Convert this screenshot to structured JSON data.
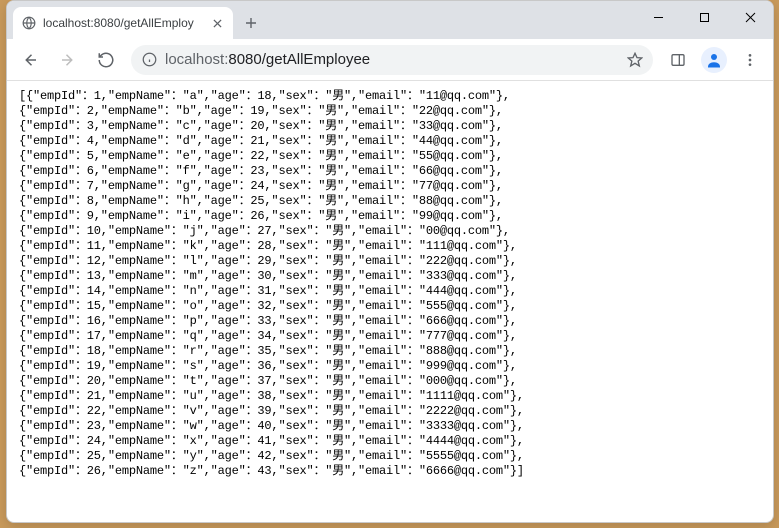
{
  "tab": {
    "title": "localhost:8080/getAllEmploy"
  },
  "url": {
    "host": "localhost:",
    "port_path": "8080/getAllEmployee"
  },
  "employees": [
    {
      "empId": 1,
      "empName": "a",
      "age": 18,
      "sex": "男",
      "email": "11@qq.com"
    },
    {
      "empId": 2,
      "empName": "b",
      "age": 19,
      "sex": "男",
      "email": "22@qq.com"
    },
    {
      "empId": 3,
      "empName": "c",
      "age": 20,
      "sex": "男",
      "email": "33@qq.com"
    },
    {
      "empId": 4,
      "empName": "d",
      "age": 21,
      "sex": "男",
      "email": "44@qq.com"
    },
    {
      "empId": 5,
      "empName": "e",
      "age": 22,
      "sex": "男",
      "email": "55@qq.com"
    },
    {
      "empId": 6,
      "empName": "f",
      "age": 23,
      "sex": "男",
      "email": "66@qq.com"
    },
    {
      "empId": 7,
      "empName": "g",
      "age": 24,
      "sex": "男",
      "email": "77@qq.com"
    },
    {
      "empId": 8,
      "empName": "h",
      "age": 25,
      "sex": "男",
      "email": "88@qq.com"
    },
    {
      "empId": 9,
      "empName": "i",
      "age": 26,
      "sex": "男",
      "email": "99@qq.com"
    },
    {
      "empId": 10,
      "empName": "j",
      "age": 27,
      "sex": "男",
      "email": "00@qq.com"
    },
    {
      "empId": 11,
      "empName": "k",
      "age": 28,
      "sex": "男",
      "email": "111@qq.com"
    },
    {
      "empId": 12,
      "empName": "l",
      "age": 29,
      "sex": "男",
      "email": "222@qq.com"
    },
    {
      "empId": 13,
      "empName": "m",
      "age": 30,
      "sex": "男",
      "email": "333@qq.com"
    },
    {
      "empId": 14,
      "empName": "n",
      "age": 31,
      "sex": "男",
      "email": "444@qq.com"
    },
    {
      "empId": 15,
      "empName": "o",
      "age": 32,
      "sex": "男",
      "email": "555@qq.com"
    },
    {
      "empId": 16,
      "empName": "p",
      "age": 33,
      "sex": "男",
      "email": "666@qq.com"
    },
    {
      "empId": 17,
      "empName": "q",
      "age": 34,
      "sex": "男",
      "email": "777@qq.com"
    },
    {
      "empId": 18,
      "empName": "r",
      "age": 35,
      "sex": "男",
      "email": "888@qq.com"
    },
    {
      "empId": 19,
      "empName": "s",
      "age": 36,
      "sex": "男",
      "email": "999@qq.com"
    },
    {
      "empId": 20,
      "empName": "t",
      "age": 37,
      "sex": "男",
      "email": "000@qq.com"
    },
    {
      "empId": 21,
      "empName": "u",
      "age": 38,
      "sex": "男",
      "email": "1111@qq.com"
    },
    {
      "empId": 22,
      "empName": "v",
      "age": 39,
      "sex": "男",
      "email": "2222@qq.com"
    },
    {
      "empId": 23,
      "empName": "w",
      "age": 40,
      "sex": "男",
      "email": "3333@qq.com"
    },
    {
      "empId": 24,
      "empName": "x",
      "age": 41,
      "sex": "男",
      "email": "4444@qq.com"
    },
    {
      "empId": 25,
      "empName": "y",
      "age": 42,
      "sex": "男",
      "email": "5555@qq.com"
    },
    {
      "empId": 26,
      "empName": "z",
      "age": 43,
      "sex": "男",
      "email": "6666@qq.com"
    }
  ]
}
